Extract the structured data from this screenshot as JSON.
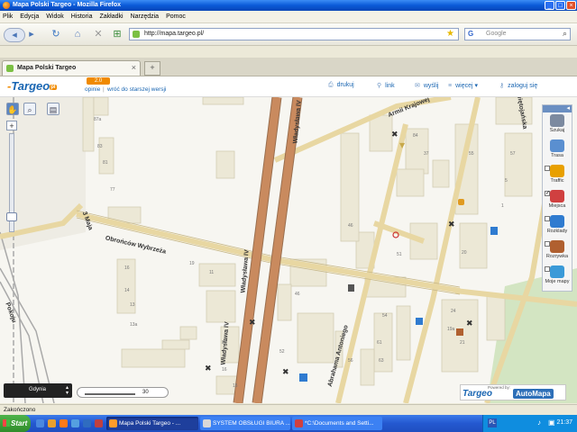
{
  "window": {
    "title": "Mapa Polski Targeo - Mozilla Firefox",
    "minimize": "_",
    "maximize": "□",
    "close": "×"
  },
  "menu": [
    "Plik",
    "Edycja",
    "Widok",
    "Historia",
    "Zakładki",
    "Narzędzia",
    "Pomoc"
  ],
  "toolbar": {
    "url": "http://mapa.targeo.pl/",
    "search_engine": "G",
    "search_placeholder": "Google"
  },
  "tab": {
    "label": "Mapa Polski Targeo",
    "close": "×",
    "newtab": "+"
  },
  "header": {
    "logo": "Targeo",
    "logo_suffix": "pl",
    "version_badge": "2.0",
    "link_opinions": "opinie",
    "link_old_version": "wróć do starszej wersji",
    "links": [
      {
        "icon": "⎙",
        "label": "drukuj"
      },
      {
        "icon": "⚲",
        "label": "link"
      },
      {
        "icon": "✉",
        "label": "wyślij"
      },
      {
        "icon": "≡",
        "label": "więcej ▾"
      },
      {
        "icon": "⚷",
        "label": "zaloguj się"
      }
    ]
  },
  "map": {
    "zoom_in": "+",
    "zoom_level_fraction": 0.88,
    "right_panel": {
      "collapse": "◂",
      "items": [
        {
          "label": "Szukaj",
          "color": "#7c8aa0"
        },
        {
          "label": "Trasa",
          "color": "#5a8fd0"
        },
        {
          "label": "Traffic",
          "color": "#e8a000",
          "checked": false
        },
        {
          "label": "Miejsca",
          "color": "#d04040",
          "checked": true
        },
        {
          "label": "Rozklady",
          "color": "#2f7bd0",
          "checked": false
        },
        {
          "label": "Rozrywka",
          "color": "#b06030",
          "checked": false
        },
        {
          "label": "Moje mapy",
          "color": "#3a9ad8",
          "checked": false
        }
      ]
    },
    "street_labels": [
      "Armii Krajowej",
      "Obrońców Wybrzeża",
      "Władysława IV",
      "Władysława IV",
      "Władysława IV",
      "3 Maja",
      "Pokoju",
      "Abrahama Antoniego",
      "Świętojańska"
    ],
    "building_numbers": [
      "87a",
      "83",
      "81",
      "77",
      "19",
      "16",
      "14",
      "13",
      "11",
      "13a",
      "20",
      "16",
      "15",
      "46",
      "51",
      "54",
      "61",
      "63",
      "84",
      "37",
      "20",
      "55",
      "57",
      "5",
      "1",
      "24",
      "19a",
      "21",
      "46",
      "52",
      "56"
    ],
    "city_select": "Gdynia",
    "scale_value": "30",
    "powered_by": "Powered by:",
    "footer_logo": "Targeo",
    "footer_brand": "AutoMapa"
  },
  "status": {
    "text": "Zakończono"
  },
  "taskbar": {
    "start": "Start",
    "items": [
      {
        "label": "Mapa Polski Targeo - ...",
        "active": true,
        "color": "#ff9c2a"
      },
      {
        "label": "SYSTEM OBSŁUGI BIURA ...",
        "active": false,
        "color": "#d8d8d8"
      },
      {
        "label": "*C:\\Documents and Setti...",
        "active": false,
        "color": "#d04040"
      }
    ],
    "lang": "PL",
    "clock": "21:37"
  },
  "colors": {
    "major_road": "#c98a5e",
    "secondary_road": "#e8d7a2",
    "building": "#ece8d6",
    "park": "#d3e5c2"
  }
}
